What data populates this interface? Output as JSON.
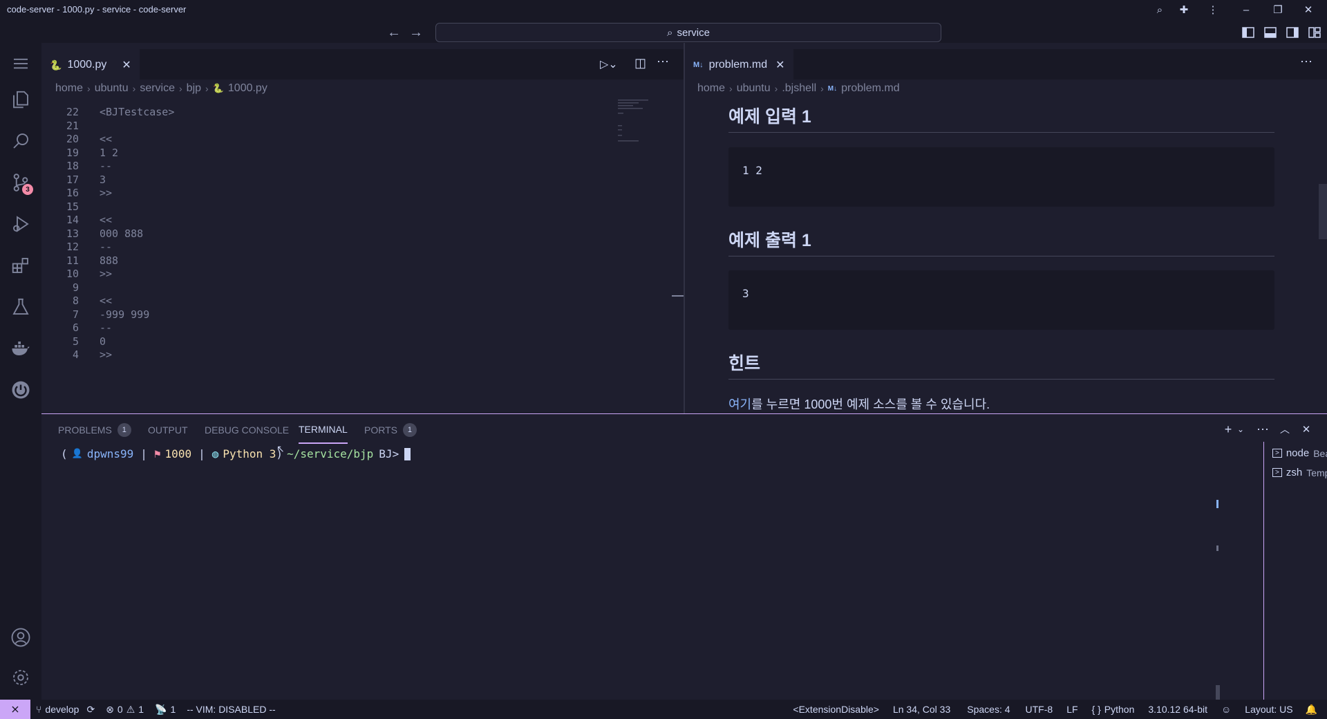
{
  "window": {
    "title": "code-server - 1000.py - service - code-server",
    "command_center": "service"
  },
  "activity_bar": {
    "items": [
      {
        "name": "explorer-icon"
      },
      {
        "name": "search-icon"
      },
      {
        "name": "source-control-icon",
        "badge": "3"
      },
      {
        "name": "run-debug-icon"
      },
      {
        "name": "extensions-icon"
      },
      {
        "name": "testing-icon"
      },
      {
        "name": "docker-icon"
      },
      {
        "name": "power-icon"
      }
    ],
    "bottom": [
      {
        "name": "account-icon"
      },
      {
        "name": "settings-gear-icon"
      }
    ]
  },
  "editor_left": {
    "tab_label": "1000.py",
    "breadcrumb": [
      "home",
      "ubuntu",
      "service",
      "bjp",
      "1000.py"
    ],
    "lines": [
      {
        "n": "22",
        "text": "<BJTestcase>"
      },
      {
        "n": "21",
        "text": ""
      },
      {
        "n": "20",
        "text": "<<"
      },
      {
        "n": "19",
        "text": "1 2"
      },
      {
        "n": "18",
        "text": "--"
      },
      {
        "n": "17",
        "text": "3"
      },
      {
        "n": "16",
        "text": ">>"
      },
      {
        "n": "15",
        "text": ""
      },
      {
        "n": "14",
        "text": "<<"
      },
      {
        "n": "13",
        "text": "000 888"
      },
      {
        "n": "12",
        "text": "--"
      },
      {
        "n": "11",
        "text": "888"
      },
      {
        "n": "10",
        "text": ">>"
      },
      {
        "n": "9",
        "text": ""
      },
      {
        "n": "8",
        "text": "<<"
      },
      {
        "n": "7",
        "text": "-999 999"
      },
      {
        "n": "6",
        "text": "--"
      },
      {
        "n": "5",
        "text": "0"
      },
      {
        "n": "4",
        "text": ">>"
      }
    ]
  },
  "editor_right": {
    "tab_label": "problem.md",
    "tab_prefix": "M↓",
    "breadcrumb": [
      "home",
      "ubuntu",
      ".bjshell",
      "problem.md"
    ],
    "sections": {
      "input_heading": "예제 입력 1",
      "input_value": "1 2",
      "output_heading": "예제 출력 1",
      "output_value": "3",
      "hint_heading": "힌트",
      "hint_link": "여기",
      "hint_text": "를 누르면 1000번 예제 소스를 볼 수 있습니다."
    }
  },
  "panel": {
    "tabs": [
      {
        "label": "PROBLEMS",
        "badge": "1"
      },
      {
        "label": "OUTPUT"
      },
      {
        "label": "DEBUG CONSOLE"
      },
      {
        "label": "TERMINAL",
        "active": true
      },
      {
        "label": "PORTS",
        "badge": "1"
      }
    ],
    "prompt": {
      "open": "(",
      "user": "dpwns99",
      "pipe1": "|",
      "problem": "1000",
      "pipe2": "|",
      "lang": "Python 3",
      "close": ")",
      "path": "~/service/bjp",
      "suffix": "BJ>"
    },
    "terminals": [
      {
        "name": "node",
        "sub": "Beakjo..."
      },
      {
        "name": "zsh",
        "sub": "Template"
      }
    ]
  },
  "status_bar": {
    "branch": "develop",
    "errors": "0",
    "warnings": "1",
    "ports": "1",
    "vim": "-- VIM: DISABLED --",
    "extension": "<ExtensionDisable>",
    "position": "Ln 34, Col 33",
    "spaces": "Spaces: 4",
    "encoding": "UTF-8",
    "eol": "LF",
    "language": "Python",
    "interpreter": "3.10.12 64-bit",
    "layout": "Layout: US"
  },
  "colors": {
    "accent": "#cba6f7",
    "background": "#1e1e2e",
    "sidebar": "#181825",
    "link": "#89b4fa",
    "path": "#a6e3a1",
    "problem": "#f9e2af",
    "badge": "#f38ba8",
    "remote": "#cba6f7"
  }
}
